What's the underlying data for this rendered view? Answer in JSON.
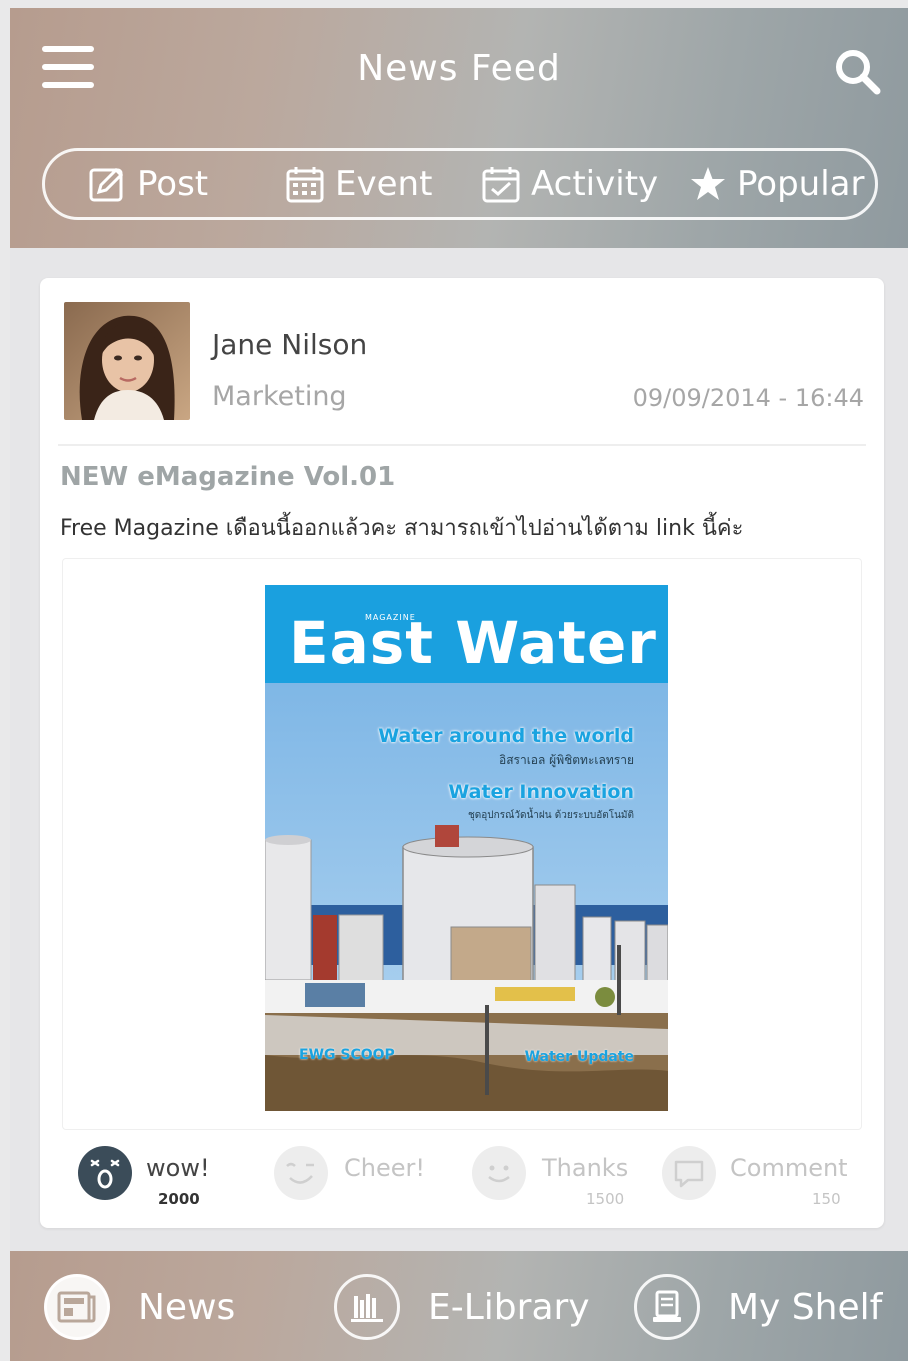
{
  "header": {
    "title": "News Feed"
  },
  "tabs": [
    {
      "label": "Post",
      "icon": "edit-icon"
    },
    {
      "label": "Event",
      "icon": "calendar-icon"
    },
    {
      "label": "Activity",
      "icon": "activity-icon"
    },
    {
      "label": "Popular",
      "icon": "star-icon"
    }
  ],
  "post": {
    "author": "Jane Nilson",
    "department": "Marketing",
    "datetime": "09/09/2014 - 16:44",
    "title": "NEW eMagazine Vol.01",
    "body": "Free Magazine เดือนนี้ออกแล้วคะ สามารถเข้าไปอ่านได้ตาม link นี้ค่ะ",
    "magazine": {
      "small_label": "MAGAZINE",
      "name": "East Water",
      "headline_1": "Water around the world",
      "subline_1": "อิสราเอล ผู้พิชิตทะเลทราย",
      "headline_2": "Water Innovation",
      "subline_2": "ชุดอุปกรณ์วัดน้ำฝน ด้วยระบบอัตโนมัติ",
      "footer_left": "EWG SCOOP",
      "footer_right": "Water Update"
    }
  },
  "reactions": [
    {
      "label": "wow!",
      "count": "2000",
      "icon": "wow-icon"
    },
    {
      "label": "Cheer!",
      "count": "",
      "icon": "cheer-icon"
    },
    {
      "label": "Thanks",
      "count": "1500",
      "icon": "thanks-icon"
    },
    {
      "label": "Comment",
      "count": "150",
      "icon": "comment-icon"
    }
  ],
  "bottom_nav": [
    {
      "label": "News",
      "icon": "news-icon"
    },
    {
      "label": "E-Library",
      "icon": "library-icon"
    },
    {
      "label": "My Shelf",
      "icon": "shelf-icon"
    }
  ],
  "colors": {
    "accent_blue": "#1aa0df",
    "header_warm": "#b69c8e",
    "header_cool": "#8f9a9f"
  }
}
